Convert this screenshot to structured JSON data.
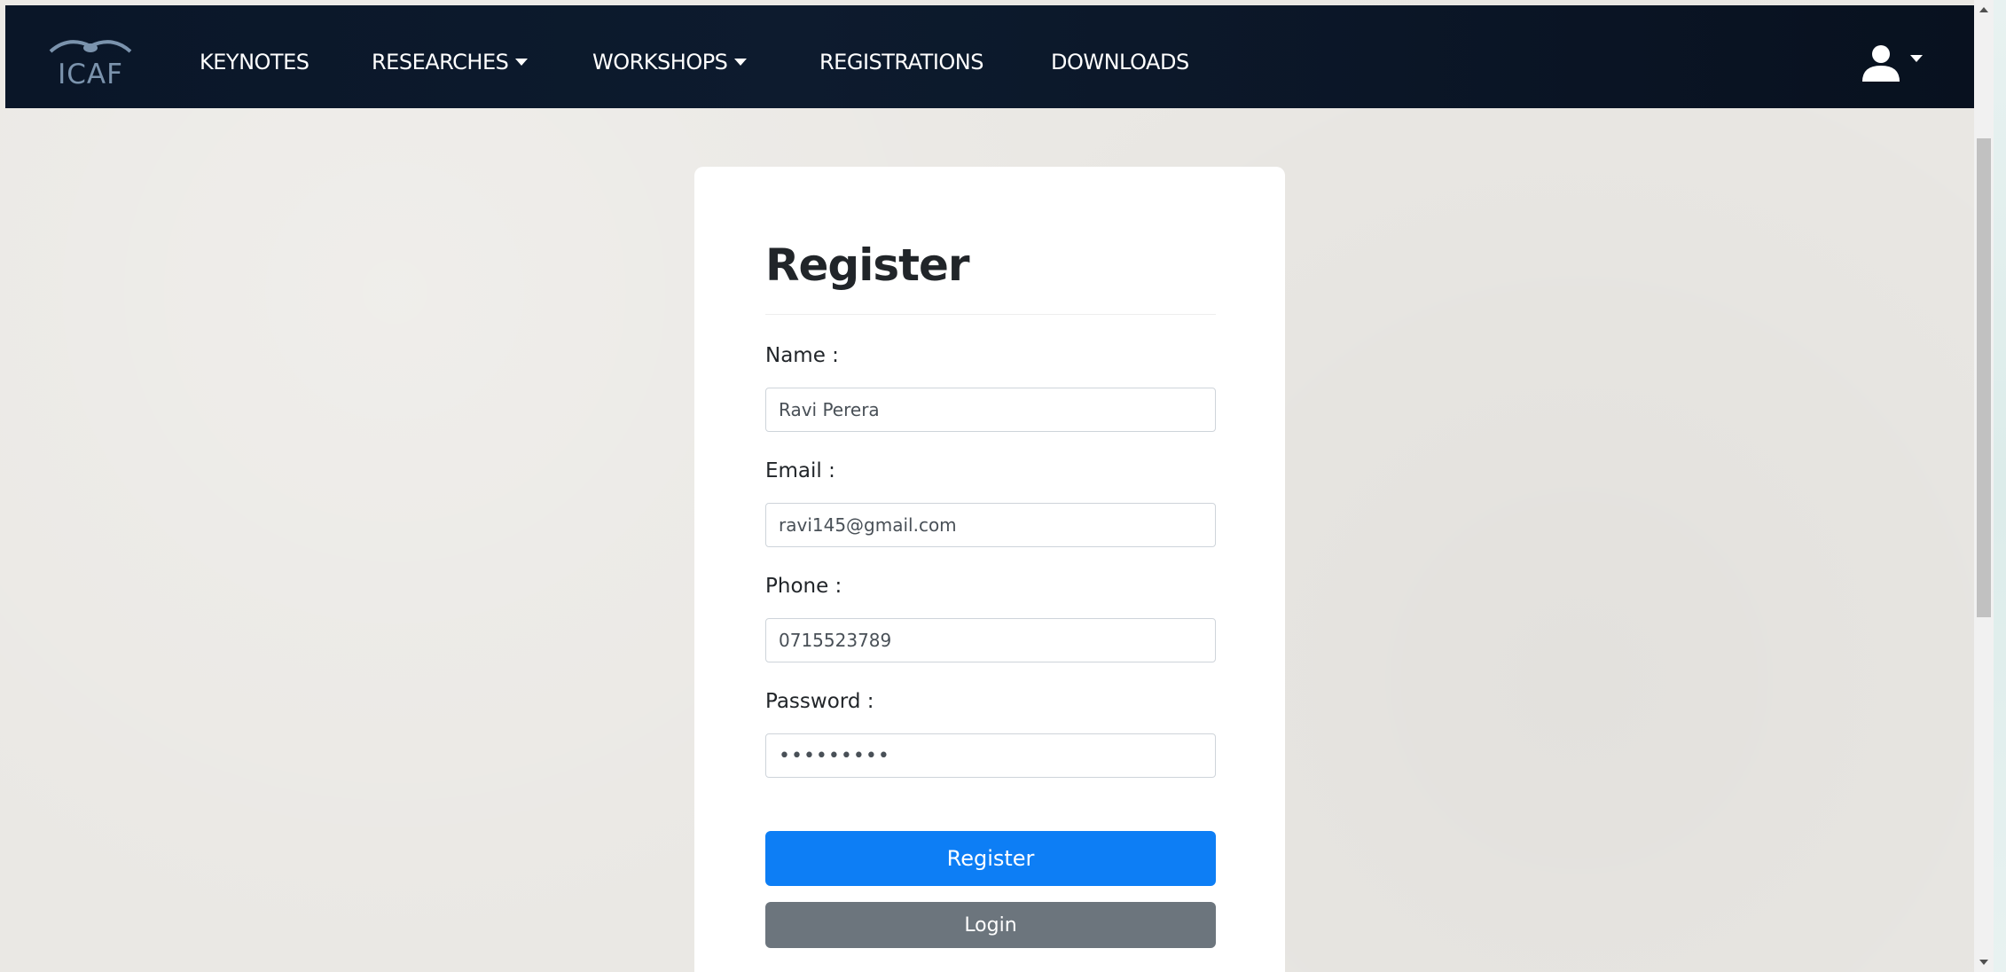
{
  "navbar": {
    "logo_text": "ICAF",
    "links": [
      {
        "label": "KEYNOTES",
        "has_dropdown": false
      },
      {
        "label": "RESEARCHES",
        "has_dropdown": true
      },
      {
        "label": "WORKSHOPS",
        "has_dropdown": true
      },
      {
        "label": "REGISTRATIONS",
        "has_dropdown": false
      },
      {
        "label": "DOWNLOADS",
        "has_dropdown": false
      }
    ],
    "user_icon": "user-icon",
    "user_caret_icon": "caret-down-icon"
  },
  "form": {
    "title": "Register",
    "fields": [
      {
        "label": "Name :",
        "value": "Ravi Perera",
        "type": "text"
      },
      {
        "label": "Email :",
        "value": "ravi145@gmail.com",
        "type": "email"
      },
      {
        "label": "Phone :",
        "value": "0715523789",
        "type": "tel"
      },
      {
        "label": "Password :",
        "value": "•••••••••",
        "type": "password"
      }
    ],
    "register_button": "Register",
    "login_button": "Login"
  },
  "colors": {
    "navbar_bg": "#0a1628",
    "page_bg": "#eae8e4",
    "primary": "#0d7ef5",
    "secondary": "#6c757d"
  }
}
